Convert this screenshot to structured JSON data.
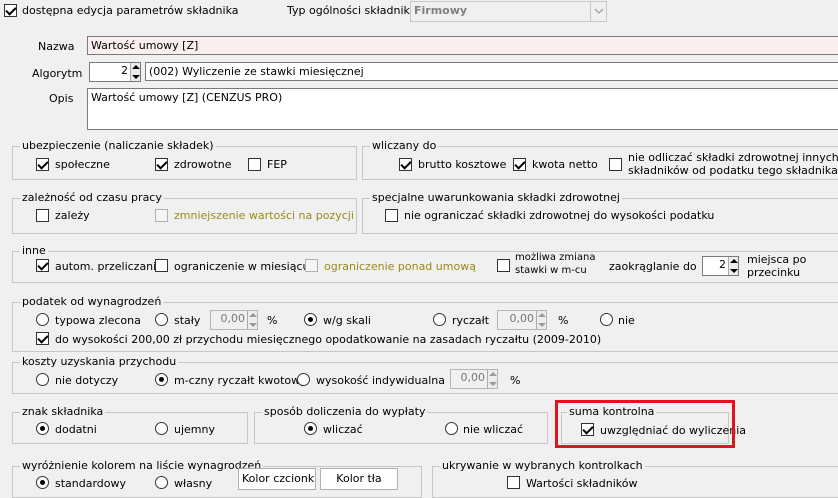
{
  "top": {
    "dostepna_label": "dostępna edycja parametrów składnika",
    "typ_label": "Typ ogólności składnika",
    "typ_value": "Firmowy"
  },
  "fields": {
    "nazwa_label": "Nazwa",
    "nazwa_value": "Wartość umowy [Z]",
    "algorytm_label": "Algorytm",
    "algorytm_num": "2",
    "algorytm_value": "(002) Wyliczenie ze stawki miesięcznej",
    "opis_label": "Opis",
    "opis_value": "Wartość  umowy    [Z] (CENZUS PRO)"
  },
  "ubezpieczenie": {
    "title": "ubezpieczenie (naliczanie składek)",
    "spoleczne": "społeczne",
    "zdrowotne": "zdrowotne",
    "fep": "FEP"
  },
  "wliczany": {
    "title": "wliczany do",
    "brutto": "brutto kosztowe",
    "netto": "kwota netto",
    "nie_odliczac_1": "nie odliczać składki zdrowotnej innych",
    "nie_odliczac_2": "składników od podatku tego składnika"
  },
  "zaleznosc": {
    "title": "zależność od czasu pracy",
    "zalezy": "zależy",
    "zmniejszenie": "zmniejszenie wartości na pozycji"
  },
  "specjalne": {
    "title": "specjalne uwarunkowania składki zdrowotnej",
    "nie_ograniczac": "nie ograniczać składki zdrowotnej do wysokości podatku"
  },
  "inne": {
    "title": "inne",
    "autom": "autom. przeliczanie",
    "ograniczenie_mies": "ograniczenie w miesiącu",
    "ograniczenie_ponad": "ograniczenie ponad umową",
    "mozliwa_1": "możliwa zmiana",
    "mozliwa_2": "stawki w m-cu",
    "zaokraglanie": "zaokrąglanie do",
    "zaokraglanie_value": "2",
    "miejsca_1": "miejsca po",
    "miejsca_2": "przecinku"
  },
  "podatek": {
    "title": "podatek od wynagrodzeń",
    "typowa": "typowa zlecona",
    "staly": "stały",
    "staly_value": "0,00",
    "pct1": "%",
    "wg_skali": "w/g skali",
    "ryczalt": "ryczałt",
    "ryczalt_value": "0,00",
    "pct2": "%",
    "nie": "nie",
    "do_wysokosci": "do wysokości 200,00 zł przychodu miesięcznego opodatkowanie na zasadach ryczałtu (2009-2010)"
  },
  "koszty": {
    "title": "koszty uzyskania przychodu",
    "nie_dotyczy": "nie dotyczy",
    "m_czny": "m-czny ryczałt kwotowy",
    "wysokosc": "wysokość indywidualna",
    "value": "0,00",
    "pct": "%"
  },
  "znak": {
    "title": "znak składnika",
    "dodatni": "dodatni",
    "ujemny": "ujemny"
  },
  "sposob": {
    "title": "sposób doliczenia do wypłaty",
    "wliczac": "wliczać",
    "nie_wliczac": "nie wliczać"
  },
  "suma": {
    "title": "suma kontrolna",
    "uwzgledniac": "uwzględniać do wyliczenia"
  },
  "wyroznienie": {
    "title": "wyróżnienie kolorem na liście wynagrodzeń",
    "standardowy": "standardowy",
    "wlasny": "własny",
    "kolor_czcionki": "Kolor czcionki",
    "kolor_tla": "Kolor tła"
  },
  "ukrywanie": {
    "title": "ukrywanie w wybranych kontrolkach",
    "wartosci": "Wartości składników"
  },
  "colors": {
    "highlight_box": "#e0141e",
    "disabled_option_text": "#9a8a1a"
  }
}
